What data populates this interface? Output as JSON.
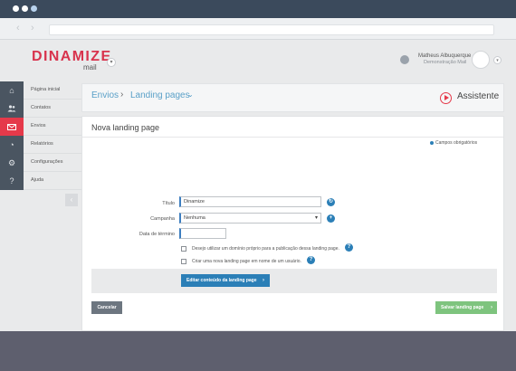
{
  "browser": {
    "window_dots": [
      {
        "name": "close",
        "color": "#ffffff"
      },
      {
        "name": "minimize",
        "color": "#ffffff"
      },
      {
        "name": "maximize",
        "color": "#b9d3ee"
      }
    ],
    "back_icon": "left-arrow-icon",
    "forward_icon": "right-arrow-icon"
  },
  "header": {
    "logo_text": "DINAMIZE",
    "logo_sub": "mail",
    "user_name": "Matheus Albuquerque",
    "user_org": "Demonstração Mail"
  },
  "sidebar": {
    "items": [
      {
        "label": "Página inicial",
        "icon": "home-icon",
        "glyph": "⌂",
        "active": false
      },
      {
        "label": "Contatos",
        "icon": "users-icon",
        "glyph": "👥",
        "active": false
      },
      {
        "label": "Envios",
        "icon": "mail-icon",
        "glyph": "✉",
        "active": true
      },
      {
        "label": "Relatórios",
        "icon": "pie-chart-icon",
        "glyph": "◔",
        "active": false
      },
      {
        "label": "Configurações",
        "icon": "gear-icon",
        "glyph": "⚙",
        "active": false
      },
      {
        "label": "Ajuda",
        "icon": "help-icon",
        "glyph": "?",
        "active": false
      }
    ],
    "collapse_glyph": "‹"
  },
  "breadcrumb": {
    "items": [
      "Envios",
      "Landing pages"
    ],
    "separator": "›",
    "caret": "⌄"
  },
  "assistant": {
    "label": "Assistente"
  },
  "form": {
    "title": "Nova landing page",
    "required_note": "Campos obrigatórios",
    "title_label": "Título",
    "title_value": "Dinamize",
    "campaign_label": "Campanha",
    "campaign_value": "Nenhuma",
    "end_date_label": "Data de término",
    "end_date_value": "",
    "option_own_domain": "Desejo utilizar um domínio próprio para a publicação dessa landing page.",
    "option_other_user": "Criar uma nova landing page em nome de um usuário.",
    "help_glyph": "?",
    "refresh_glyph": "↻",
    "add_glyph": "+",
    "select_caret": "▾"
  },
  "actions": {
    "edit_content": "Editar conteúdo da landing page",
    "cancel": "Cancelar",
    "save": "Salvar landing page",
    "chevron": "›"
  },
  "colors": {
    "brand": "#d8334d",
    "active_nav": "#e5394a",
    "primary": "#2b7fb7",
    "save": "#7ec47e",
    "cancel": "#6d7680"
  }
}
